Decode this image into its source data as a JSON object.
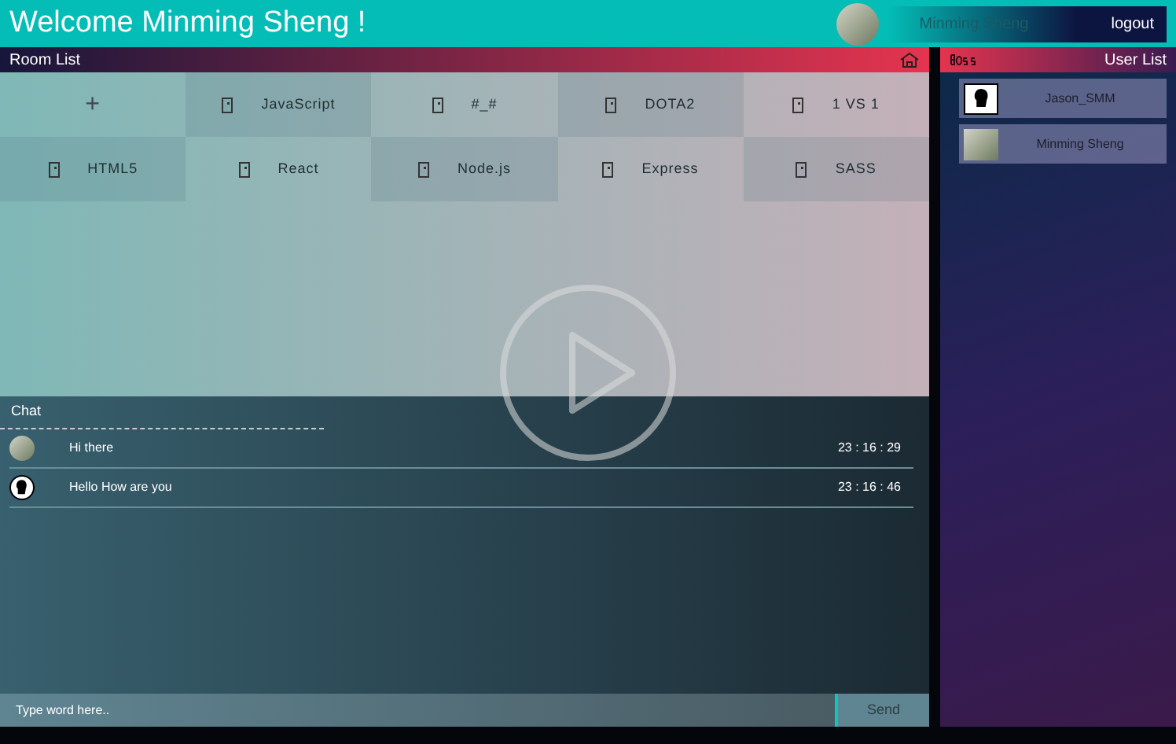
{
  "header": {
    "title": "Welcome Minming Sheng !",
    "user_name": "Minming Sheng",
    "logout": "logout"
  },
  "room_list": {
    "title": "Room List",
    "add": "+",
    "rooms": [
      {
        "name": "JavaScript"
      },
      {
        "name": "#_#"
      },
      {
        "name": "DOTA2"
      },
      {
        "name": "1 VS 1"
      },
      {
        "name": "HTML5"
      },
      {
        "name": "React"
      },
      {
        "name": "Node.js"
      },
      {
        "name": "Express"
      },
      {
        "name": "SASS"
      }
    ]
  },
  "user_list": {
    "title": "User List",
    "users": [
      {
        "name": "Jason_SMM",
        "kind": "silhouette"
      },
      {
        "name": "Minming Sheng",
        "kind": "photo"
      }
    ]
  },
  "chat": {
    "title": "Chat",
    "messages": [
      {
        "text": "Hi there",
        "time": "23 : 16 : 29",
        "kind": "photo"
      },
      {
        "text": "Hello How are you",
        "time": "23 : 16 : 46",
        "kind": "silhouette"
      }
    ]
  },
  "composer": {
    "placeholder": "Type word here..",
    "button": "Send"
  }
}
